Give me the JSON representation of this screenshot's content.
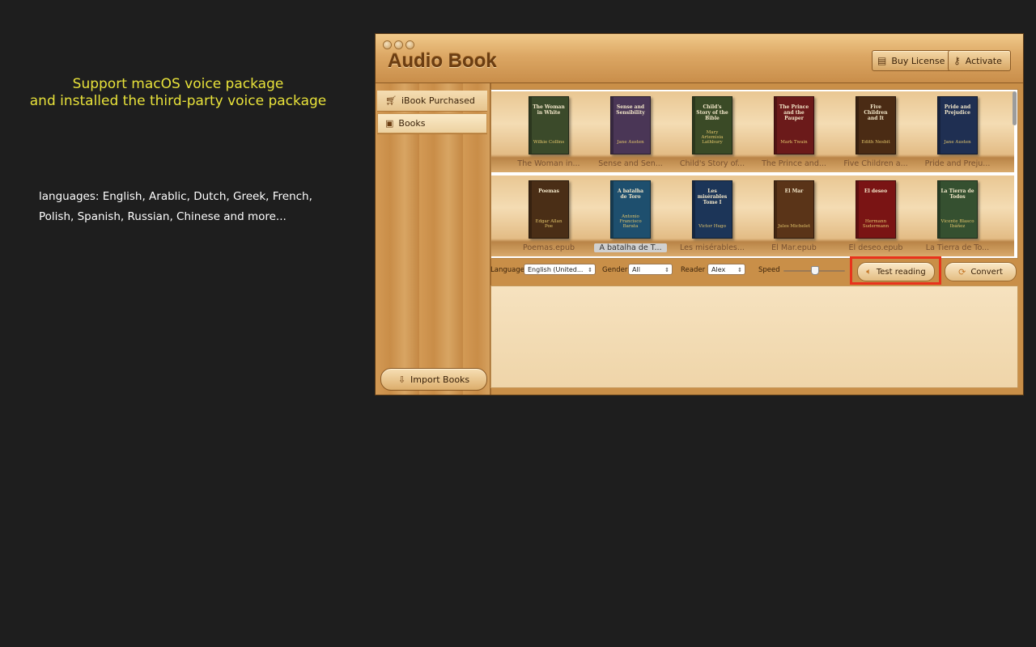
{
  "promo": {
    "headline_line1": "Support macOS voice package",
    "headline_line2": "and installed the third-party voice package",
    "languages_line1": "languages: English, Arablic, Dutch, Greek, French,",
    "languages_line2": "Polish, Spanish, Russian, Chinese and more..."
  },
  "window": {
    "title": "Audio Book",
    "buy_license_label": "Buy License",
    "activate_label": "Activate"
  },
  "sidebar": {
    "items": [
      {
        "label": "iBook Purchased",
        "icon": "cart-icon"
      },
      {
        "label": "Books",
        "icon": "book-icon"
      }
    ],
    "import_label": "Import Books"
  },
  "shelf": {
    "books": [
      {
        "title": "The Woman in White",
        "author": "Wilkie Collins",
        "caption": "The Woman in...",
        "color": "#3b4a2a"
      },
      {
        "title": "Sense and Sensibility",
        "author": "Jane Austen",
        "caption": "Sense and Sen...",
        "color": "#4a3656"
      },
      {
        "title": "Child's Story of the Bible",
        "author": "Mary Artemisia Lathbury",
        "caption": "Child's Story of...",
        "color": "#3a4a26"
      },
      {
        "title": "The Prince and the Pauper",
        "author": "Mark Twain",
        "caption": "The Prince and...",
        "color": "#6b1a1a"
      },
      {
        "title": "Five Children and It",
        "author": "Edith Nesbit",
        "caption": "Five Children a...",
        "color": "#4a2b14"
      },
      {
        "title": "Pride and Prejudice",
        "author": "Jane Austen",
        "caption": "Pride and Preju...",
        "color": "#1f2f52"
      },
      {
        "title": "Poemas",
        "author": "Edgar Allan Poe",
        "caption": "Poemas.epub",
        "color": "#4a2e16"
      },
      {
        "title": "A batalha de Toro",
        "author": "Antonio Francisco Barata",
        "caption": "A batalha de T...",
        "color": "#1e4f6e"
      },
      {
        "title": "Les misérables Tome I",
        "author": "Victor Hugo",
        "caption": "Les misérables...",
        "color": "#1c3558"
      },
      {
        "title": "El Mar",
        "author": "Jules Michelet",
        "caption": "El Mar.epub",
        "color": "#5a3418"
      },
      {
        "title": "El deseo",
        "author": "Hermann Sudermann",
        "caption": "El deseo.epub",
        "color": "#7a1414"
      },
      {
        "title": "La Tierra de Todos",
        "author": "Vicente Blasco Ibáñez",
        "caption": "La Tierra de To...",
        "color": "#355030"
      }
    ]
  },
  "controls": {
    "language_label": "Language",
    "language_value": "English (United...",
    "gender_label": "Gender",
    "gender_value": "All",
    "reader_label": "Reader",
    "reader_value": "Alex",
    "speed_label": "Speed",
    "test_reading_label": "Test reading",
    "convert_label": "Convert"
  },
  "colors": {
    "accent_highlight": "#e8331c",
    "promo_text": "#e8e23a",
    "background": "#1e1e1e"
  }
}
